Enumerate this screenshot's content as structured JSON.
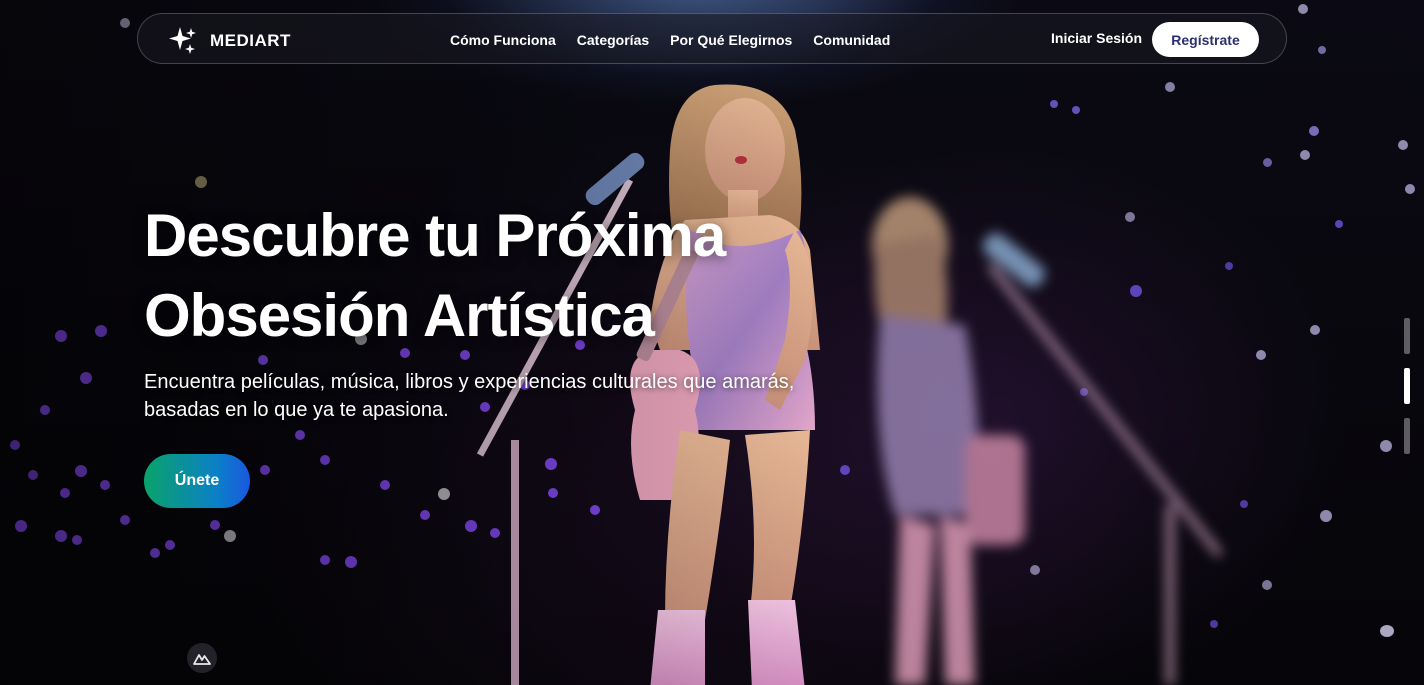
{
  "brand": {
    "name": "MEDIART",
    "icon": "sparkles-icon"
  },
  "nav": {
    "links": [
      "Cómo Funciona",
      "Categorías",
      "Por Qué Elegirnos",
      "Comunidad"
    ],
    "login_label": "Iniciar Sesión",
    "register_label": "Regístrate"
  },
  "hero": {
    "title_line1": "Descubre tu Próxima",
    "title_line2": "Obsesión Artística",
    "subtitle": "Encuentra películas, música, libros y experiencias culturales que amarás, basadas en lo que ya te apasiona.",
    "cta_label": "Únete",
    "background": "concert-performer-image"
  },
  "slides": {
    "count": 3,
    "active": 2
  },
  "colors": {
    "cta_gradient_start": "#0aa36a",
    "cta_gradient_end": "#1a57e0",
    "register_text": "#2a2f72",
    "bokeh": "#7b3cff"
  }
}
